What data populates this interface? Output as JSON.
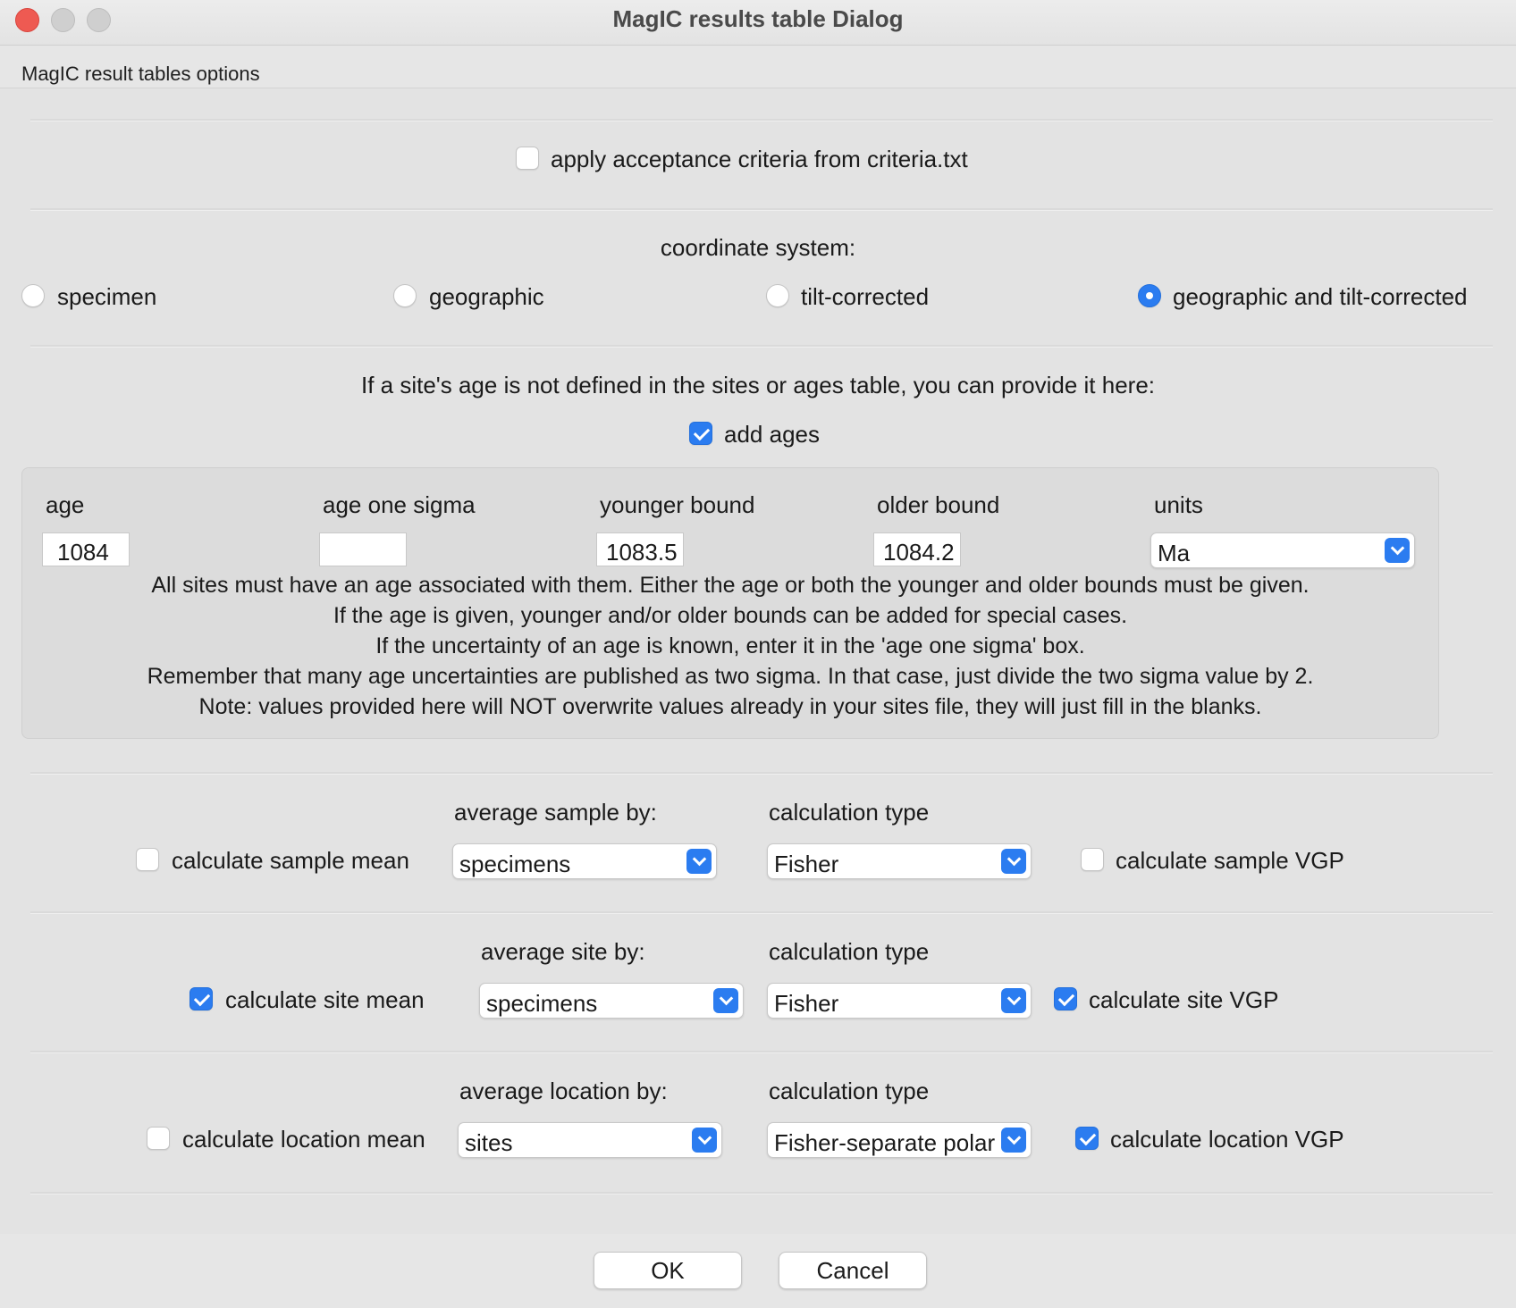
{
  "window": {
    "title": "MagIC results table Dialog"
  },
  "panel_label": "MagIC result tables options",
  "criteria": {
    "label": "apply acceptance criteria from criteria.txt",
    "checked": false
  },
  "coordinate_system": {
    "heading": "coordinate system:",
    "options": [
      {
        "label": "specimen",
        "selected": false
      },
      {
        "label": "geographic",
        "selected": false
      },
      {
        "label": "tilt-corrected",
        "selected": false
      },
      {
        "label": "geographic and tilt-corrected",
        "selected": true
      }
    ]
  },
  "ages": {
    "prompt": "If a site's age is not defined in the sites or ages table, you can provide it here:",
    "add_ages_label": "add ages",
    "add_ages_checked": true,
    "headers": [
      "age",
      "age one sigma",
      "younger bound",
      "older bound",
      "units"
    ],
    "values": {
      "age": "1084",
      "sigma": "",
      "younger": "1083.5",
      "older": "1084.2",
      "units": "Ma"
    },
    "notes": [
      "All sites must have an age associated with them. Either the age or both the younger and older bounds must be given.",
      "If the age is given, younger and/or older bounds can be added for special cases.",
      "If the uncertainty of an age is known, enter it in the 'age one sigma' box.",
      "Remember that many age uncertainties are published as two sigma. In that case, just divide the two sigma value by 2.",
      "Note: values provided here will NOT overwrite values already in your sites file, they will just fill in the blanks."
    ]
  },
  "sample": {
    "mean_label": "calculate sample mean",
    "mean_checked": false,
    "avg_heading": "average sample by:",
    "avg_value": "specimens",
    "calc_heading": "calculation type",
    "calc_value": "Fisher",
    "vgp_label": "calculate sample VGP",
    "vgp_checked": false
  },
  "site": {
    "mean_label": "calculate site mean",
    "mean_checked": true,
    "avg_heading": "average site by:",
    "avg_value": "specimens",
    "calc_heading": "calculation type",
    "calc_value": "Fisher",
    "vgp_label": "calculate site VGP",
    "vgp_checked": true
  },
  "location": {
    "mean_label": "calculate location mean",
    "mean_checked": false,
    "avg_heading": "average location by:",
    "avg_value": "sites",
    "calc_heading": "calculation type",
    "calc_value": "Fisher-separate polarities",
    "vgp_label": "calculate location VGP",
    "vgp_checked": true
  },
  "buttons": {
    "ok": "OK",
    "cancel": "Cancel"
  }
}
